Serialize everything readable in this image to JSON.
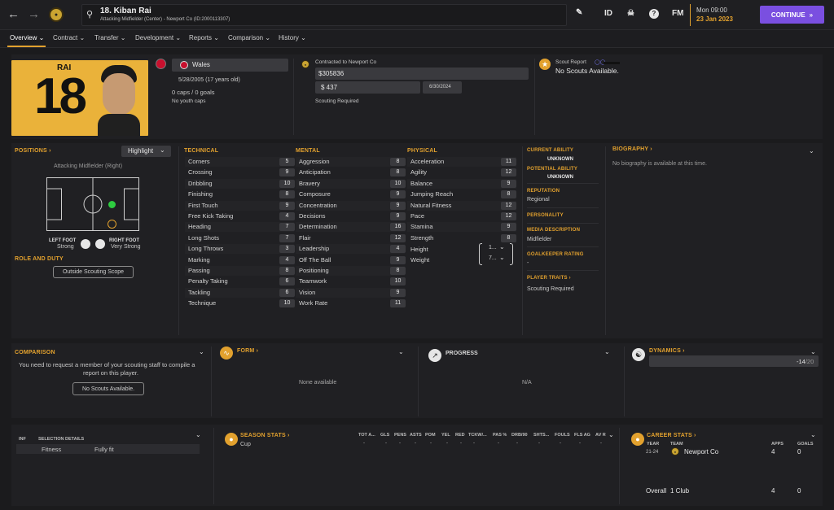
{
  "header": {
    "player_title": "18. Kiban Rai",
    "player_subtitle": "Attacking Midfielder (Center) - Newport Co (ID:2000113307)",
    "id_label": "ID",
    "fm_label": "FM",
    "date_time": "Mon 09:00",
    "date": "23 Jan 2023",
    "continue_label": "CONTINUE"
  },
  "tabs": [
    {
      "label": "Overview"
    },
    {
      "label": "Contract"
    },
    {
      "label": "Transfer"
    },
    {
      "label": "Development"
    },
    {
      "label": "Reports"
    },
    {
      "label": "Comparison"
    },
    {
      "label": "History"
    }
  ],
  "profile": {
    "shirt_name": "RAI",
    "shirt_number": "18",
    "nationality": "Wales",
    "dob": "5/28/2005 (17 years old)",
    "caps": "0 caps / 0 goals",
    "youth_caps": "No youth caps",
    "contract_label": "Contracted to Newport Co",
    "contract_value": "$305836",
    "wage": "$ 437",
    "contract_end": "6/30/2024",
    "scouting_required": "Scouting Required",
    "scout_report_label": "Scout Report",
    "scout_report_value": "No Scouts Available."
  },
  "positions": {
    "title": "POSITIONS",
    "highlight_label": "Highlight",
    "position_name": "Attacking Midfielder (Right)",
    "left_foot_label": "LEFT FOOT",
    "left_foot_value": "Strong",
    "right_foot_label": "RIGHT FOOT",
    "right_foot_value": "Very Strong",
    "role_title": "ROLE AND DUTY",
    "scouting_scope": "Outside Scouting Scope"
  },
  "technical": {
    "title": "TECHNICAL",
    "items": [
      {
        "name": "Corners",
        "value": "5"
      },
      {
        "name": "Crossing",
        "value": "9"
      },
      {
        "name": "Dribbling",
        "value": "10"
      },
      {
        "name": "Finishing",
        "value": "8"
      },
      {
        "name": "First Touch",
        "value": "9"
      },
      {
        "name": "Free Kick Taking",
        "value": "4"
      },
      {
        "name": "Heading",
        "value": "7"
      },
      {
        "name": "Long Shots",
        "value": "7"
      },
      {
        "name": "Long Throws",
        "value": "3"
      },
      {
        "name": "Marking",
        "value": "4"
      },
      {
        "name": "Passing",
        "value": "8"
      },
      {
        "name": "Penalty Taking",
        "value": "6"
      },
      {
        "name": "Tackling",
        "value": "6"
      },
      {
        "name": "Technique",
        "value": "10"
      }
    ]
  },
  "mental": {
    "title": "MENTAL",
    "items": [
      {
        "name": "Aggression",
        "value": "8"
      },
      {
        "name": "Anticipation",
        "value": "8"
      },
      {
        "name": "Bravery",
        "value": "10"
      },
      {
        "name": "Composure",
        "value": "9"
      },
      {
        "name": "Concentration",
        "value": "9"
      },
      {
        "name": "Decisions",
        "value": "9"
      },
      {
        "name": "Determination",
        "value": "16"
      },
      {
        "name": "Flair",
        "value": "12"
      },
      {
        "name": "Leadership",
        "value": "4"
      },
      {
        "name": "Off The Ball",
        "value": "9"
      },
      {
        "name": "Positioning",
        "value": "8"
      },
      {
        "name": "Teamwork",
        "value": "10"
      },
      {
        "name": "Vision",
        "value": "9"
      },
      {
        "name": "Work Rate",
        "value": "11"
      }
    ]
  },
  "physical": {
    "title": "PHYSICAL",
    "items": [
      {
        "name": "Acceleration",
        "value": "11"
      },
      {
        "name": "Agility",
        "value": "12"
      },
      {
        "name": "Balance",
        "value": "9"
      },
      {
        "name": "Jumping Reach",
        "value": "8"
      },
      {
        "name": "Natural Fitness",
        "value": "12"
      },
      {
        "name": "Pace",
        "value": "12"
      },
      {
        "name": "Stamina",
        "value": "9"
      },
      {
        "name": "Strength",
        "value": "8"
      }
    ],
    "height_label": "Height",
    "height_value": "1...",
    "weight_label": "Weight",
    "weight_value": "7..."
  },
  "ability": {
    "current_label": "CURRENT ABILITY",
    "current_value": "UNKNOWN",
    "potential_label": "POTENTIAL ABILITY",
    "potential_value": "UNKNOWN",
    "reputation_label": "REPUTATION",
    "reputation_value": "Regional",
    "personality_label": "PERSONALITY",
    "media_label": "MEDIA DESCRIPTION",
    "media_value": "Midfielder",
    "gk_label": "GOALKEEPER RATING",
    "gk_value": "-",
    "traits_label": "PLAYER TRAITS",
    "traits_value": "Scouting Required"
  },
  "biography": {
    "title": "BIOGRAPHY",
    "text": "No biography is available at this time."
  },
  "comparison": {
    "title": "COMPARISON",
    "text_line1": "You need to request a member of your scouting staff to compile a",
    "text_line2": "report on this player.",
    "button": "No Scouts Available."
  },
  "form": {
    "title": "FORM",
    "value": "None available"
  },
  "progress": {
    "title": "PROGRESS",
    "value": "N/A"
  },
  "dynamics": {
    "title": "DYNAMICS",
    "value": "-14",
    "max": "/20"
  },
  "selection": {
    "inf_label": "INF",
    "details_label": "SELECTION DETAILS",
    "fitness_label": "Fitness",
    "fitness_value": "Fully fit"
  },
  "season_stats": {
    "title": "SEASON STATS",
    "competition": "Cup",
    "columns": [
      "TOT A...",
      "GLS",
      "PENS",
      "ASTS",
      "POM",
      "YEL",
      "RED",
      "TCKW/...",
      "PAS %",
      "DRB/90",
      "SHTS...",
      "FOULS",
      "FLS AG",
      "AV R"
    ],
    "values": [
      "-",
      "-",
      "-",
      "-",
      "-",
      "-",
      "-",
      "-",
      "-",
      "-",
      "-",
      "-",
      "-",
      "-"
    ]
  },
  "career_stats": {
    "title": "CAREER STATS",
    "year_label": "YEAR",
    "team_label": "TEAM",
    "apps_label": "APPS",
    "goals_label": "GOALS",
    "row_year": "21-24",
    "row_team": "Newport Co",
    "row_apps": "4",
    "row_goals": "0",
    "overall_label": "Overall",
    "overall_clubs": "1 Club",
    "overall_apps": "4",
    "overall_goals": "0"
  },
  "colors": {
    "accent": "#e2a12e",
    "continue": "#7a4fe0",
    "pitch_dot": "#2ecc40"
  }
}
